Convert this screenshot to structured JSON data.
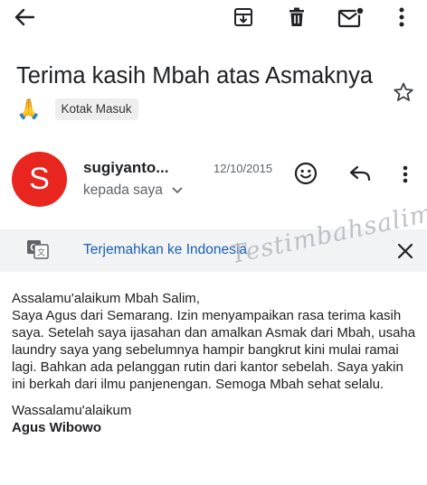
{
  "toolbar": {
    "back_icon": "arrow-back-icon",
    "archive_icon": "archive-icon",
    "delete_icon": "trash-icon",
    "mark_unread_icon": "mail-unread-icon",
    "more_icon": "more-vert-icon"
  },
  "subject": {
    "text": "Terima kasih Mbah atas Asmaknya",
    "emoji": "🙏",
    "label": "Kotak Masuk"
  },
  "message": {
    "avatar_letter": "S",
    "avatar_color": "#e8251f",
    "sender": "sugiyanto...",
    "date": "12/10/2015",
    "recipient": "kepada saya"
  },
  "translate": {
    "link": "Terjemahkan ke Indonesia"
  },
  "body": {
    "greeting": "Assalamu'alaikum Mbah Salim,",
    "paragraph": "Saya Agus dari Semarang. Izin menyampaikan rasa terima kasih saya. Setelah saya ijasahan dan amalkan Asmak dari Mbah, usaha laundry saya yang sebelumnya hampir bangkrut kini mulai ramai lagi. Bahkan ada pelanggan rutin dari kantor sebelah. Saya yakin ini berkah dari ilmu panjenengan. Semoga Mbah sehat selalu.",
    "closing": "Wassalamu'alaikum",
    "signature": "Agus Wibowo"
  },
  "watermark": "Testimbahsalim"
}
